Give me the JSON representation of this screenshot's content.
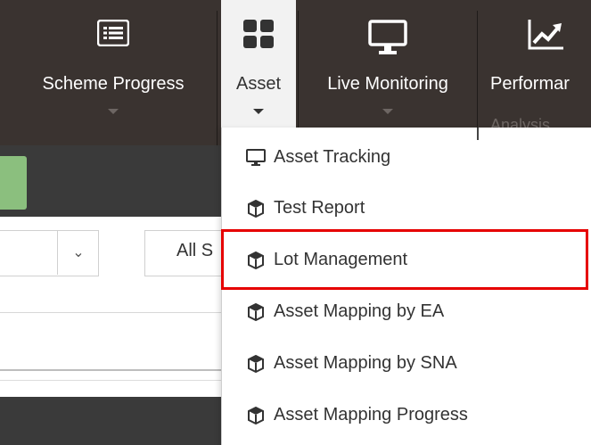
{
  "nav": {
    "items": [
      {
        "label": "Scheme Progress",
        "icon": "list-icon"
      },
      {
        "label": "Asset",
        "icon": "grid-icon"
      },
      {
        "label": "Live Monitoring",
        "icon": "monitor-icon"
      },
      {
        "label": "Performar",
        "icon": "chart-icon"
      }
    ],
    "overflow_label": "Analysis"
  },
  "page": {
    "filter_text": "All S"
  },
  "dropdown": {
    "items": [
      {
        "label": "Asset Tracking",
        "icon": "monitor-icon"
      },
      {
        "label": "Test Report",
        "icon": "cube-icon"
      },
      {
        "label": "Lot Management",
        "icon": "cube-icon"
      },
      {
        "label": "Asset Mapping by EA",
        "icon": "cube-icon"
      },
      {
        "label": "Asset Mapping by SNA",
        "icon": "cube-icon"
      },
      {
        "label": "Asset Mapping Progress",
        "icon": "cube-icon"
      }
    ],
    "highlighted": "Lot Management"
  },
  "colors": {
    "navbar": "#3a3330",
    "active_tab": "#f2f2f2",
    "highlight": "#e60000"
  }
}
